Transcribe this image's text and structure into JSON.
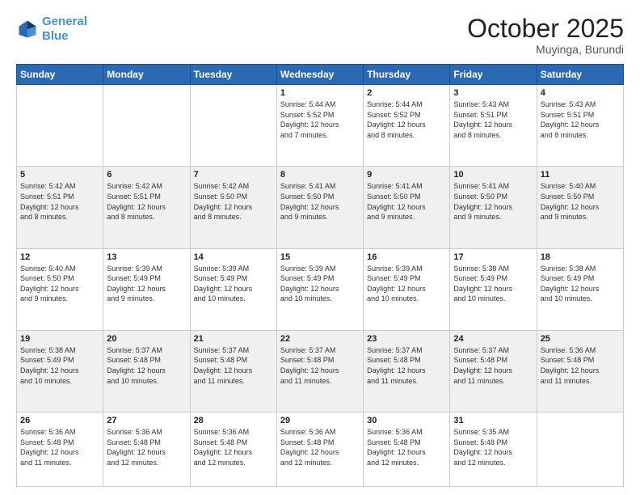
{
  "header": {
    "logo_line1": "General",
    "logo_line2": "Blue",
    "month": "October 2025",
    "location": "Muyinga, Burundi"
  },
  "weekdays": [
    "Sunday",
    "Monday",
    "Tuesday",
    "Wednesday",
    "Thursday",
    "Friday",
    "Saturday"
  ],
  "weeks": [
    [
      {
        "day": "",
        "info": ""
      },
      {
        "day": "",
        "info": ""
      },
      {
        "day": "",
        "info": ""
      },
      {
        "day": "1",
        "info": "Sunrise: 5:44 AM\nSunset: 5:52 PM\nDaylight: 12 hours\nand 7 minutes."
      },
      {
        "day": "2",
        "info": "Sunrise: 5:44 AM\nSunset: 5:52 PM\nDaylight: 12 hours\nand 8 minutes."
      },
      {
        "day": "3",
        "info": "Sunrise: 5:43 AM\nSunset: 5:51 PM\nDaylight: 12 hours\nand 8 minutes."
      },
      {
        "day": "4",
        "info": "Sunrise: 5:43 AM\nSunset: 5:51 PM\nDaylight: 12 hours\nand 8 minutes."
      }
    ],
    [
      {
        "day": "5",
        "info": "Sunrise: 5:42 AM\nSunset: 5:51 PM\nDaylight: 12 hours\nand 8 minutes."
      },
      {
        "day": "6",
        "info": "Sunrise: 5:42 AM\nSunset: 5:51 PM\nDaylight: 12 hours\nand 8 minutes."
      },
      {
        "day": "7",
        "info": "Sunrise: 5:42 AM\nSunset: 5:50 PM\nDaylight: 12 hours\nand 8 minutes."
      },
      {
        "day": "8",
        "info": "Sunrise: 5:41 AM\nSunset: 5:50 PM\nDaylight: 12 hours\nand 9 minutes."
      },
      {
        "day": "9",
        "info": "Sunrise: 5:41 AM\nSunset: 5:50 PM\nDaylight: 12 hours\nand 9 minutes."
      },
      {
        "day": "10",
        "info": "Sunrise: 5:41 AM\nSunset: 5:50 PM\nDaylight: 12 hours\nand 9 minutes."
      },
      {
        "day": "11",
        "info": "Sunrise: 5:40 AM\nSunset: 5:50 PM\nDaylight: 12 hours\nand 9 minutes."
      }
    ],
    [
      {
        "day": "12",
        "info": "Sunrise: 5:40 AM\nSunset: 5:50 PM\nDaylight: 12 hours\nand 9 minutes."
      },
      {
        "day": "13",
        "info": "Sunrise: 5:39 AM\nSunset: 5:49 PM\nDaylight: 12 hours\nand 9 minutes."
      },
      {
        "day": "14",
        "info": "Sunrise: 5:39 AM\nSunset: 5:49 PM\nDaylight: 12 hours\nand 10 minutes."
      },
      {
        "day": "15",
        "info": "Sunrise: 5:39 AM\nSunset: 5:49 PM\nDaylight: 12 hours\nand 10 minutes."
      },
      {
        "day": "16",
        "info": "Sunrise: 5:39 AM\nSunset: 5:49 PM\nDaylight: 12 hours\nand 10 minutes."
      },
      {
        "day": "17",
        "info": "Sunrise: 5:38 AM\nSunset: 5:49 PM\nDaylight: 12 hours\nand 10 minutes."
      },
      {
        "day": "18",
        "info": "Sunrise: 5:38 AM\nSunset: 5:49 PM\nDaylight: 12 hours\nand 10 minutes."
      }
    ],
    [
      {
        "day": "19",
        "info": "Sunrise: 5:38 AM\nSunset: 5:49 PM\nDaylight: 12 hours\nand 10 minutes."
      },
      {
        "day": "20",
        "info": "Sunrise: 5:37 AM\nSunset: 5:48 PM\nDaylight: 12 hours\nand 10 minutes."
      },
      {
        "day": "21",
        "info": "Sunrise: 5:37 AM\nSunset: 5:48 PM\nDaylight: 12 hours\nand 11 minutes."
      },
      {
        "day": "22",
        "info": "Sunrise: 5:37 AM\nSunset: 5:48 PM\nDaylight: 12 hours\nand 11 minutes."
      },
      {
        "day": "23",
        "info": "Sunrise: 5:37 AM\nSunset: 5:48 PM\nDaylight: 12 hours\nand 11 minutes."
      },
      {
        "day": "24",
        "info": "Sunrise: 5:37 AM\nSunset: 5:48 PM\nDaylight: 12 hours\nand 11 minutes."
      },
      {
        "day": "25",
        "info": "Sunrise: 5:36 AM\nSunset: 5:48 PM\nDaylight: 12 hours\nand 11 minutes."
      }
    ],
    [
      {
        "day": "26",
        "info": "Sunrise: 5:36 AM\nSunset: 5:48 PM\nDaylight: 12 hours\nand 11 minutes."
      },
      {
        "day": "27",
        "info": "Sunrise: 5:36 AM\nSunset: 5:48 PM\nDaylight: 12 hours\nand 12 minutes."
      },
      {
        "day": "28",
        "info": "Sunrise: 5:36 AM\nSunset: 5:48 PM\nDaylight: 12 hours\nand 12 minutes."
      },
      {
        "day": "29",
        "info": "Sunrise: 5:36 AM\nSunset: 5:48 PM\nDaylight: 12 hours\nand 12 minutes."
      },
      {
        "day": "30",
        "info": "Sunrise: 5:36 AM\nSunset: 5:48 PM\nDaylight: 12 hours\nand 12 minutes."
      },
      {
        "day": "31",
        "info": "Sunrise: 5:35 AM\nSunset: 5:48 PM\nDaylight: 12 hours\nand 12 minutes."
      },
      {
        "day": "",
        "info": ""
      }
    ]
  ]
}
